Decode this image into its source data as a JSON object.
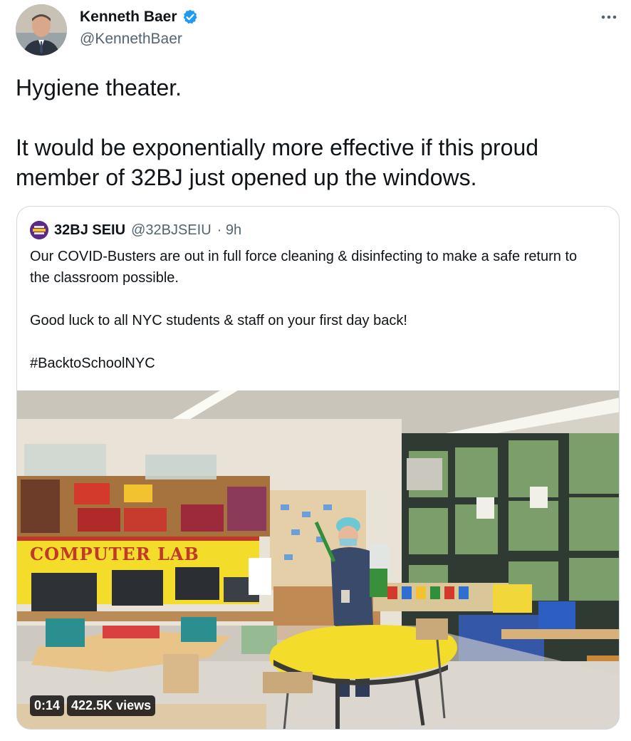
{
  "tweet": {
    "author": {
      "name": "Kenneth Baer",
      "handle": "@KennethBaer",
      "verified": true
    },
    "text": "Hygiene theater.\n\nIt would be exponentially more effective if this proud member of 32BJ just opened up the windows."
  },
  "quote": {
    "author": {
      "name": "32BJ SEIU",
      "handle": "@32BJSEIU",
      "time": "· 9h"
    },
    "text": "Our COVID-Busters are out in full force cleaning & disinfecting to make a safe return to the classroom possible.\n\nGood luck to all NYC students & staff on your first day back!\n\n#BacktoSchoolNYC",
    "media": {
      "sign_text": "COMPUTER LAB",
      "duration": "0:14",
      "views": "422.5K views"
    }
  },
  "colors": {
    "verified": "#1d9bf0",
    "handle": "#536471",
    "border": "#cfd9de"
  },
  "icons": [
    "verified-badge-icon",
    "more-options-icon"
  ]
}
